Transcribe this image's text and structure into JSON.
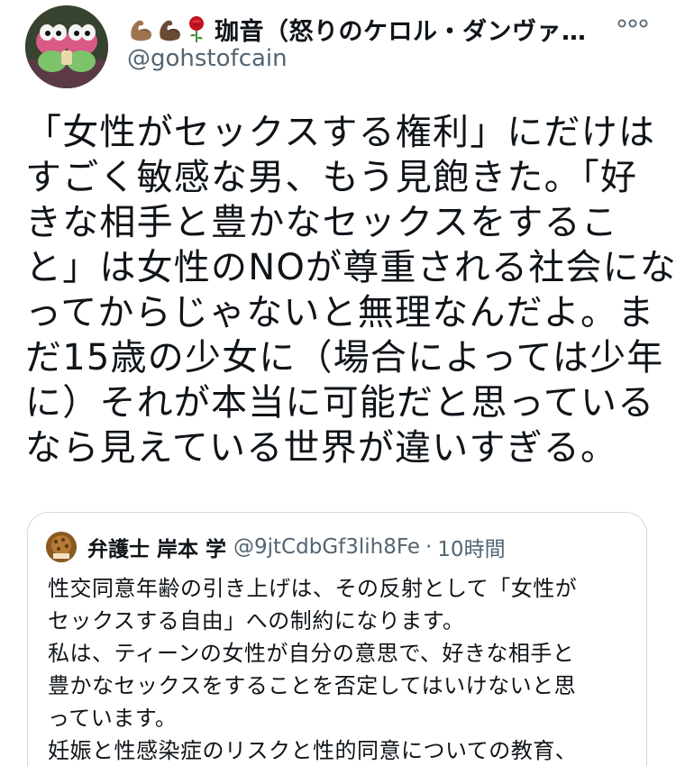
{
  "tweet": {
    "author": {
      "display_name": "珈音（怒りのケロル・ダンヴァ…",
      "handle": "@gohstofcain",
      "emoji_icons": [
        "flexed-biceps-icon",
        "flexed-biceps-icon",
        "rose-icon"
      ]
    },
    "more_icon": "more-options-icon",
    "text_lines": [
      "「女性がセックスする権利」にだけは",
      "すごく敏感な男、もう見飽きた。「好",
      "きな相手と豊かなセックスをするこ",
      "と」は女性のNOが尊重される社会にな",
      "ってからじゃないと無理なんだよ。ま",
      "だ15歳の少女に（場合によっては少年",
      "に）それが本当に可能だと思っている",
      "なら見えている世界が違いすぎる。"
    ]
  },
  "quoted_tweet": {
    "display_name": "弁護士 岸本 学",
    "handle": "@9jtCdbGf3lih8Fe",
    "separator": "·",
    "time": "10時間",
    "text_lines": [
      "性交同意年齢の引き上げは、その反射として「女性が",
      "セックスする自由」への制約になります。",
      "私は、ティーンの女性が自分の意思で、好きな相手と",
      "豊かなセックスをすることを否定してはいけないと思",
      "っています。",
      "妊娠と性感染症のリスクと性的同意についての教育、"
    ]
  },
  "colors": {
    "text_primary": "#0f1419",
    "text_secondary": "#536471",
    "border": "#cfd9de"
  }
}
